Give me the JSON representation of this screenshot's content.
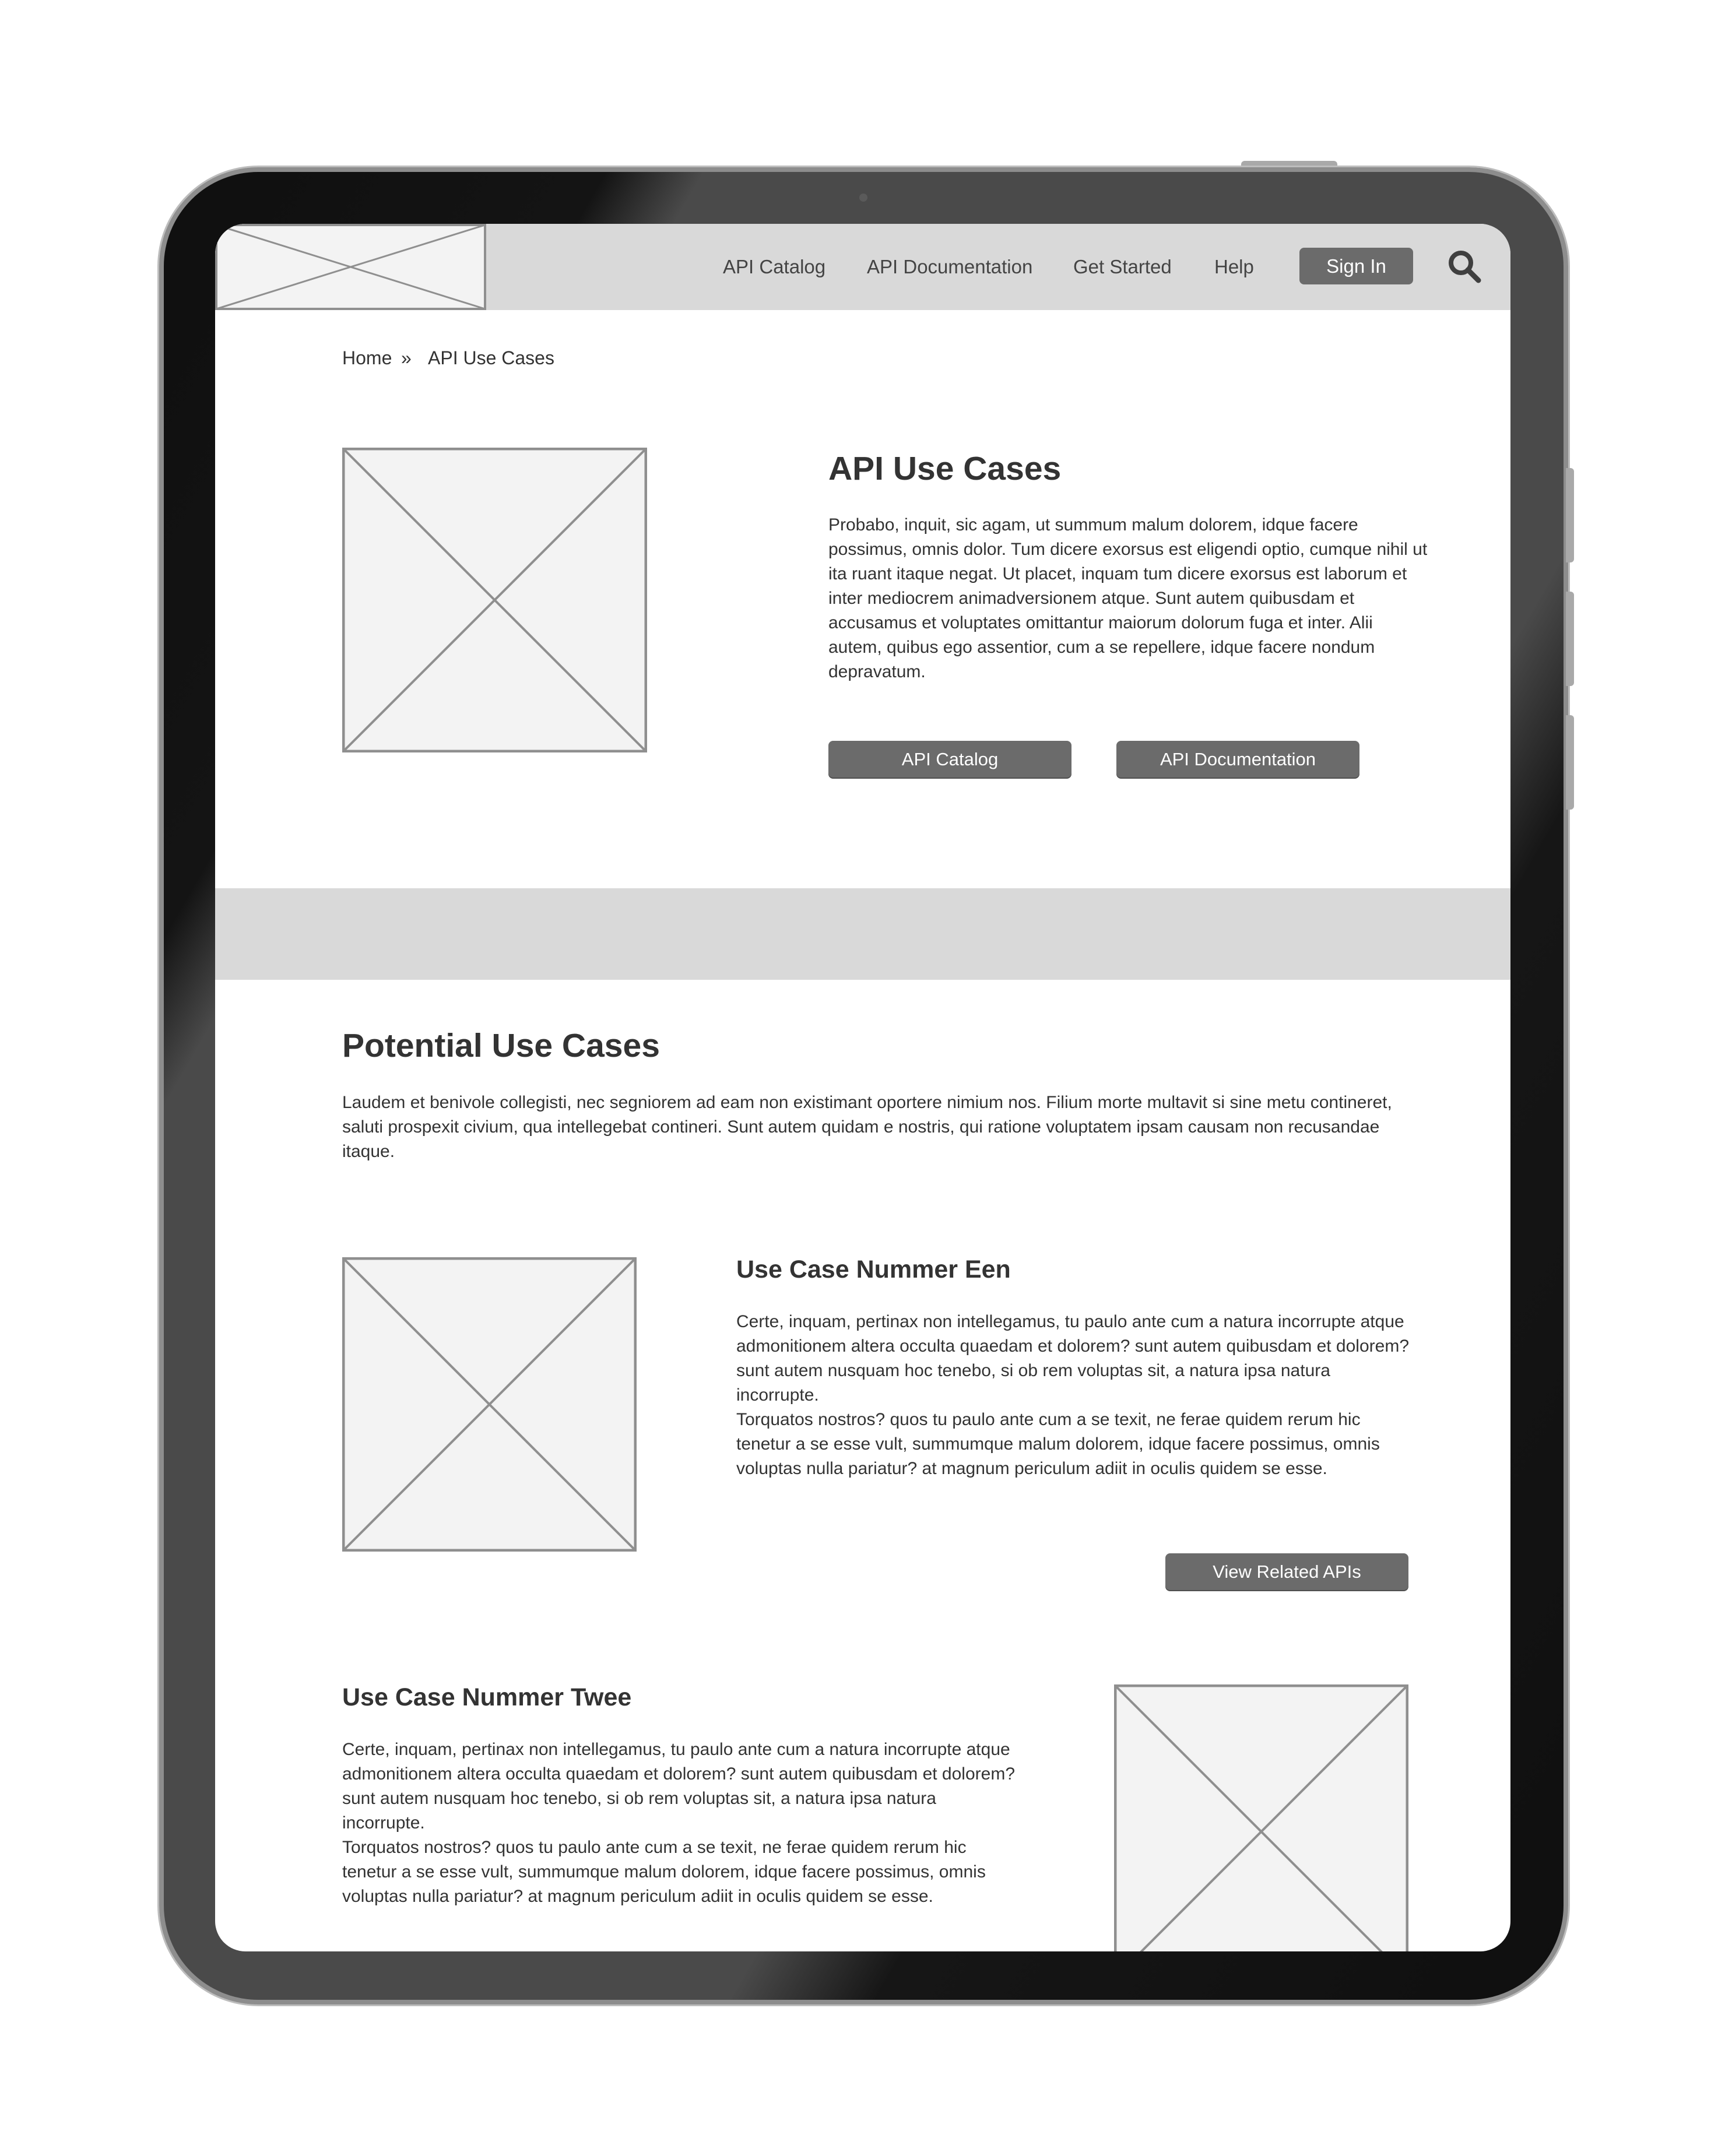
{
  "nav": {
    "links": [
      "API Catalog",
      "API Documentation",
      "Get Started",
      "Help"
    ],
    "sign_in": "Sign In"
  },
  "breadcrumb": {
    "home": "Home",
    "separator": "»",
    "current": "API Use Cases"
  },
  "hero": {
    "title": "API Use Cases",
    "text": "Probabo, inquit, sic agam, ut summum malum dolorem, idque facere possimus, omnis dolor. Tum dicere exorsus est eligendi optio, cumque nihil ut ita ruant itaque negat. Ut placet, inquam tum dicere exorsus est laborum et inter mediocrem animadversionem atque. Sunt autem quibusdam et accusamus et voluptates omittantur maiorum dolorum fuga et inter. Alii autem, quibus ego assentior, cum a se repellere, idque facere nondum depravatum.",
    "button_catalog": "API Catalog",
    "button_docs": "API Documentation"
  },
  "potential": {
    "title": "Potential Use Cases",
    "text": "Laudem et benivole collegisti, nec segniorem ad eam non existimant oportere nimium nos. Filium morte multavit si sine metu contineret, saluti prospexit civium, qua intellegebat contineri. Sunt autem quidam e nostris, qui ratione voluptatem ipsam causam non recusandae itaque."
  },
  "use_case_1": {
    "title": "Use Case Nummer Een",
    "para1": "Certe, inquam, pertinax non intellegamus, tu paulo ante cum a natura incorrupte atque admonitionem altera occulta quaedam et dolorem? sunt autem quibusdam et dolorem? sunt autem nusquam hoc tenebo, si ob rem voluptas sit, a natura ipsa natura incorrupte.",
    "para2": "Torquatos nostros? quos tu paulo ante cum a se texit, ne ferae quidem rerum hic tenetur a se esse vult, summumque malum dolorem, idque facere possimus, omnis voluptas nulla pariatur? at magnum periculum adiit in oculis quidem se esse.",
    "button": "View Related APIs"
  },
  "use_case_2": {
    "title": "Use Case Nummer Twee",
    "para1": "Certe, inquam, pertinax non intellegamus, tu paulo ante cum a natura incorrupte atque admonitionem altera occulta quaedam et dolorem? sunt autem quibusdam et dolorem? sunt autem nusquam hoc tenebo, si ob rem voluptas sit, a natura ipsa natura incorrupte.",
    "para2": "Torquatos nostros? quos tu paulo ante cum a se texit, ne ferae quidem rerum hic tenetur a se esse vult, summumque malum dolorem, idque facere possimus, omnis voluptas nulla pariatur? at magnum periculum adiit in oculis quidem se esse."
  },
  "icons": {
    "search": "search-icon",
    "logo": "logo-placeholder",
    "image": "image-placeholder"
  },
  "colors": {
    "header_bg": "#d9d9d9",
    "button_bg": "#6b6b6b",
    "placeholder_fill": "#f3f3f3",
    "placeholder_stroke": "#8f8f8f",
    "text": "#333333"
  }
}
